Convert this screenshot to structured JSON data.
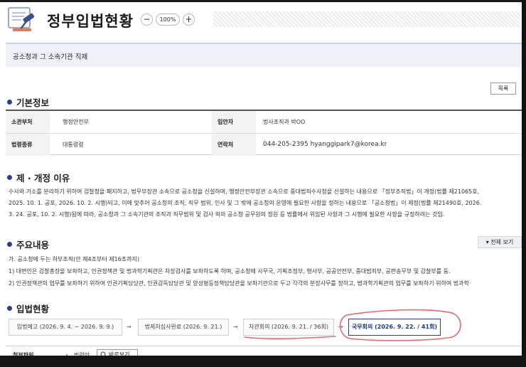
{
  "header": {
    "title": "정부입법현황",
    "zoom": {
      "minus": "−",
      "value": "100%",
      "plus": "+"
    }
  },
  "subtitle": "공소청과 그 소속기관 직제",
  "list_button": "목록",
  "basic_info": {
    "title": "기본정보",
    "rows": [
      {
        "label1": "소관부처",
        "value1": "행정안전부",
        "label2": "입안자",
        "value2": "법사조직과 박OO"
      },
      {
        "label1": "법령종류",
        "value1": "대통령령",
        "label2": "연락처",
        "value2": "044-205-2395   hyanggipark7@korea.kr"
      }
    ]
  },
  "reason": {
    "title": "제 · 개정 이유",
    "lines": [
      "수사와 기소를 분리하기 위하여 검찰청을 폐지하고, 법무부장관 소속으로 공소청을 신설하며, 행정안전부장관 소속으로 중대범죄수사청을 신설하는 내용으로 「정부조직법」이 개정(법률 제21065호,",
      "2025. 10. 1. 공포, 2026. 10. 2. 시행)되고, 이에 맞추어 공소청의 조직, 직무 범위, 인사 및 그 밖에 공소청의 운영에 필요한 사항을 정하는 내용으로 「공소청법」이 제정(법률 제21490호, 2026.",
      "3. 24. 공포, 10. 2. 시행)됨에 따라, 공소청과 그 소속기관의 조직과 직무범위 및 검사 외의 공소청 공무원의 정원 등 법률에서 위임된 사항과 그 시행에 필요한 사항을 규정하려는 것임."
    ]
  },
  "main_content": {
    "title": "주요내용",
    "view_all": "▾ 전체 보기",
    "lines": [
      "가. 공소청에 두는 하부조직(안 제4조부터 제16조까지)",
      "1) 대변인은 검찰총장을 보좌하고, 인권정책관 및 법과학기획관은 차장검사를 보좌하도록 하며, 공소청에 사무국, 기획조정부, 형사부, 공공안전부, 중대범죄부, 공판송무부 및 감찰부를 둠.",
      "2) 인권정책관의 업무를 보좌하기 위하여 인권기획담당관, 인권감독담당관 및 양성평등정책담당관을 보좌기관으로 두고 각각의 분장사무를 정하고, 법과학기획관의 업무를 보좌하기 위하여 법과학·"
    ]
  },
  "legislation_status": {
    "title": "입법현황",
    "stages": [
      "입법예고 (2026. 9. 4. ~ 2026. 9. 9.)",
      "법제처심사완료 (2026. 9. 21.)",
      "차관회의 (2026. 9. 21. / 36회)",
      "국무회의 (2026. 9. 22. / 41회)"
    ],
    "arrow": "→",
    "current_stage_index": 3
  },
  "attachments": {
    "label": "첨부파일",
    "file_label": "법령안",
    "view_button": "바로보기"
  },
  "colors": {
    "accent": "#2a3f8a",
    "annotation": "#e06a75",
    "subtitle_bg": "#eef2f8"
  }
}
